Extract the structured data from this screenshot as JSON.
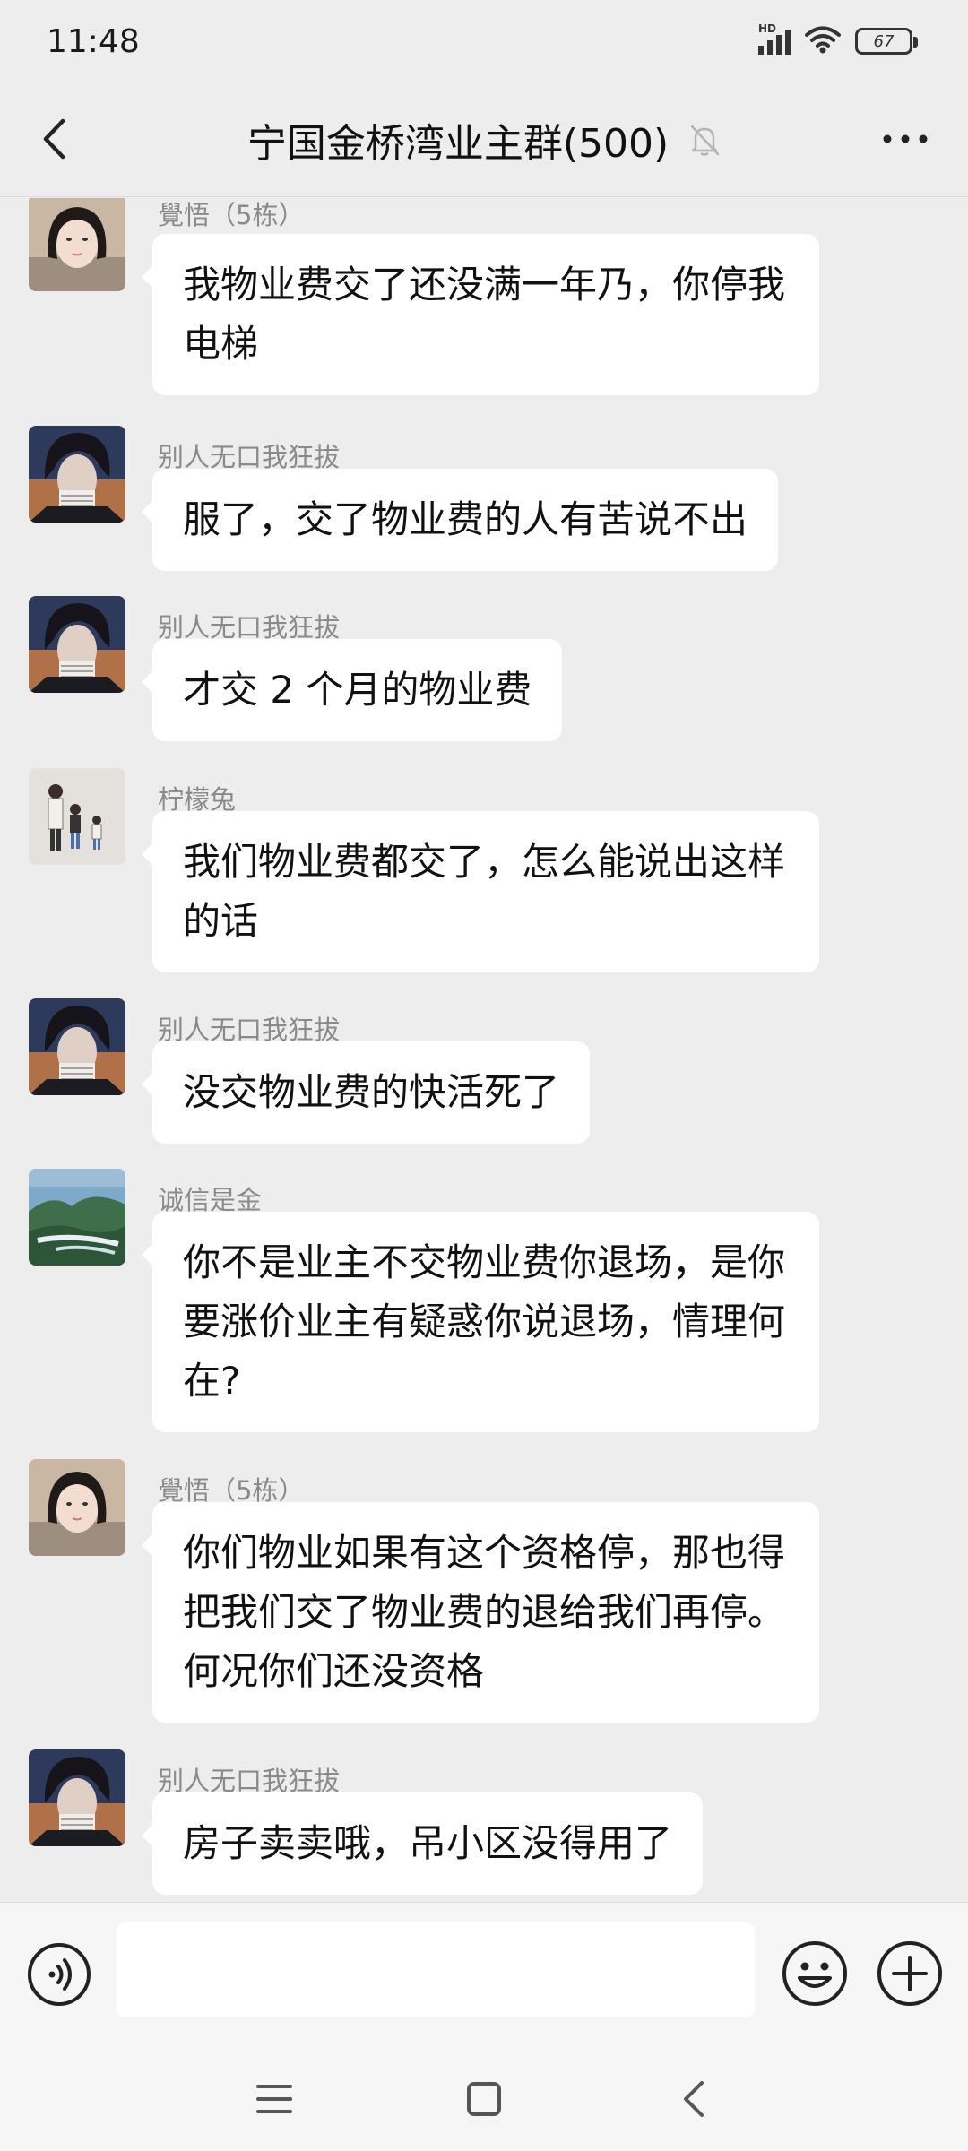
{
  "status_bar": {
    "time": "11:48",
    "network": "HD",
    "battery": "67"
  },
  "header": {
    "title": "宁国金桥湾业主群(500)"
  },
  "messages": [
    {
      "sender": "覺悟（5栋）",
      "text": "我物业费交了还没满一年乃，你停我电梯",
      "avatar": "girl-avatar"
    },
    {
      "sender": "别人无口我狂拔",
      "text": "服了，交了物业费的人有苦说不出",
      "avatar": "anime-avatar"
    },
    {
      "sender": "别人无口我狂拔",
      "text": "才交 2 个月的物业费",
      "avatar": "anime-avatar"
    },
    {
      "sender": "柠檬兔",
      "text": "我们物业费都交了，怎么能说出这样的话",
      "avatar": "family-avatar"
    },
    {
      "sender": "别人无口我狂拔",
      "text": "没交物业费的快活死了",
      "avatar": "anime-avatar"
    },
    {
      "sender": "诚信是金",
      "text": "你不是业主不交物业费你退场，是你要涨价业主有疑惑你说退场，情理何在?",
      "avatar": "landscape-avatar"
    },
    {
      "sender": "覺悟（5栋）",
      "text": "你们物业如果有这个资格停，那也得把我们交了物业费的退给我们再停。何况你们还没资格",
      "avatar": "girl-avatar"
    },
    {
      "sender": "别人无口我狂拔",
      "text": "房子卖卖哦，吊小区没得用了",
      "avatar": "anime-avatar"
    }
  ],
  "input": {
    "value": "",
    "placeholder": ""
  },
  "colors": {
    "background": "#ededed",
    "bubble": "#ffffff",
    "sender_name": "#8a8a8a"
  }
}
